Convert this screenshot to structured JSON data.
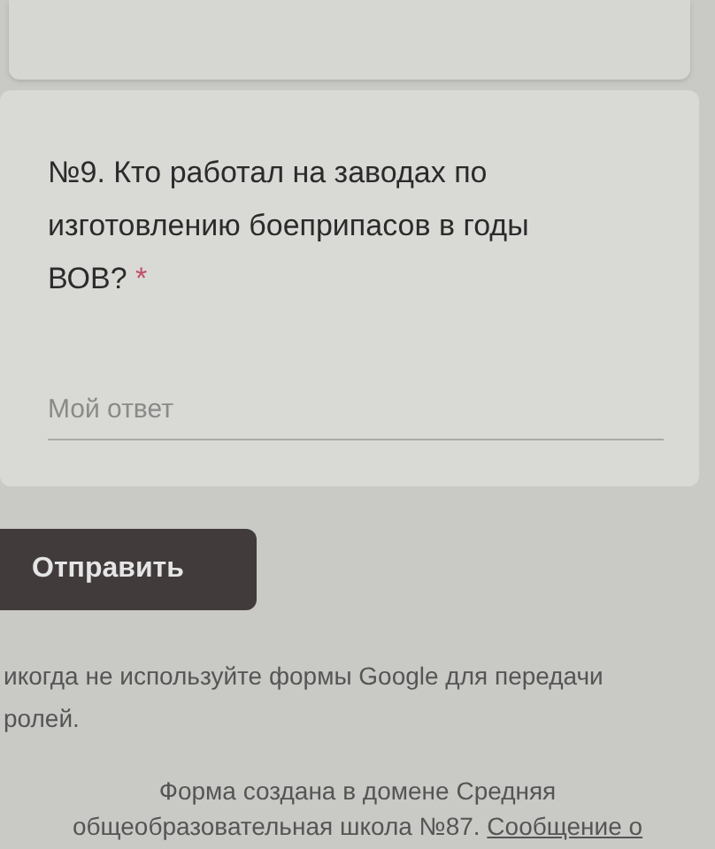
{
  "question": {
    "title": "№9. Кто работал на заводах по изготовлению боеприпасов в годы ВОВ?",
    "required_mark": "*"
  },
  "answer": {
    "placeholder": "Мой ответ"
  },
  "submit_button": "Отправить",
  "warning_lines": [
    "икогда не используйте формы Google для передачи",
    "ролей."
  ],
  "footer": {
    "text": "Форма создана в домене Средняя общеобразовательная школа №87.",
    "link": "Сообщение о"
  }
}
